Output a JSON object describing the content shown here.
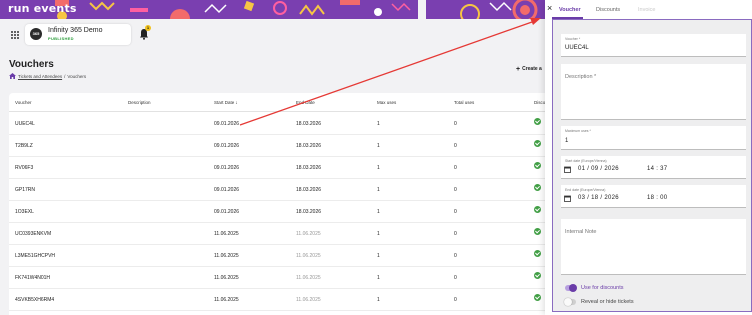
{
  "brand": {
    "logo_text": "run events",
    "accent": "#6a3ca8",
    "banner": "#7a3fb0"
  },
  "header": {
    "event_name": "Infinity 365 Demo",
    "event_status": "PUBLISHED",
    "event_icon": "365",
    "notification_count": "1"
  },
  "page": {
    "title": "Vouchers",
    "breadcrumb": {
      "parent": "Tickets and Attendees",
      "separator": "/",
      "current": "Vouchers"
    },
    "create_button": "Create a"
  },
  "table": {
    "columns": [
      "Voucher",
      "Description",
      "Start Date",
      "End Date",
      "Max uses",
      "Total uses",
      "Disco"
    ],
    "rows": [
      [
        "UUEC4L",
        "",
        "09.01.2026",
        "18.03.2026",
        "1",
        "0"
      ],
      [
        "T2B9LZ",
        "",
        "09.01.2026",
        "18.03.2026",
        "1",
        "0"
      ],
      [
        "RV06F3",
        "",
        "09.01.2026",
        "18.03.2026",
        "1",
        "0"
      ],
      [
        "GP17RN",
        "",
        "09.01.2026",
        "18.03.2026",
        "1",
        "0"
      ],
      [
        "1O3EXL",
        "",
        "09.01.2026",
        "18.03.2026",
        "1",
        "0"
      ],
      [
        "UC0393ENKVM",
        "",
        "11.06.2025",
        "11.06.2025",
        "1",
        "0"
      ],
      [
        "L3ME51GHCPVH",
        "",
        "11.06.2025",
        "11.06.2025",
        "1",
        "0"
      ],
      [
        "FK741W4N01H",
        "",
        "11.06.2025",
        "11.06.2025",
        "1",
        "0"
      ],
      [
        "4SVKB5XH6RM4",
        "",
        "11.06.2025",
        "11.06.2025",
        "1",
        "0"
      ]
    ]
  },
  "panel": {
    "close": "×",
    "tabs": [
      "Voucher",
      "Discounts",
      "Invoice"
    ],
    "voucher_label": "Voucher *",
    "voucher_value": "UUEC4L",
    "description_label": "Description *",
    "max_uses_label": "Maximum uses *",
    "max_uses_value": "1",
    "start_label": "Start date (Europe/Vienna)",
    "start_date": "01 / 09 / 2026",
    "start_time": "14 : 37",
    "end_label": "End date (Europe/Vienna)",
    "end_date": "03 / 18 / 2026",
    "end_time": "18 : 00",
    "internal_note_label": "Internal Note",
    "use_for_discounts": "Use for discounts",
    "reveal_hide": "Reveal or hide tickets"
  }
}
